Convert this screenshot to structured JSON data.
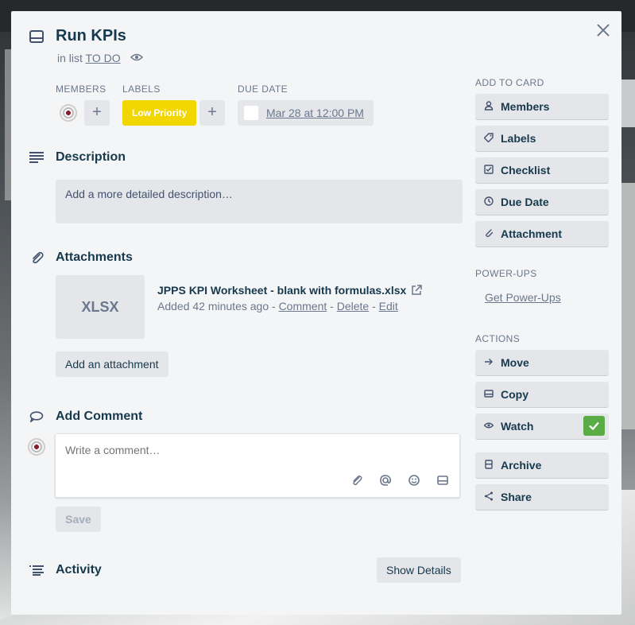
{
  "card": {
    "title": "Run KPIs",
    "in_list_prefix": "in list",
    "list_name": "TO DO"
  },
  "fields": {
    "members_label": "MEMBERS",
    "labels_label": "LABELS",
    "due_label": "DUE DATE",
    "label_chip": "Low Priority",
    "label_color": "#f2d600",
    "due_date": "Mar 28 at 12:00 PM"
  },
  "description": {
    "heading": "Description",
    "placeholder": "Add a more detailed description…"
  },
  "attachments": {
    "heading": "Attachments",
    "thumb_text": "XLSX",
    "file_name": "JPPS KPI Worksheet - blank with formulas.xlsx",
    "added": "Added 42 minutes ago",
    "sep": "-",
    "comment_link": "Comment",
    "delete_link": "Delete",
    "edit_link": "Edit",
    "add_button": "Add an attachment"
  },
  "comment": {
    "heading": "Add Comment",
    "placeholder": "Write a comment…",
    "save_button": "Save"
  },
  "activity": {
    "heading": "Activity",
    "show_details": "Show Details"
  },
  "sidebar": {
    "add_to_card_label": "ADD TO CARD",
    "add_items": [
      {
        "label": "Members",
        "icon": "person-icon"
      },
      {
        "label": "Labels",
        "icon": "tag-icon"
      },
      {
        "label": "Checklist",
        "icon": "checklist-icon"
      },
      {
        "label": "Due Date",
        "icon": "clock-icon"
      },
      {
        "label": "Attachment",
        "icon": "paperclip-icon"
      }
    ],
    "powerups_label": "POWER-UPS",
    "powerups_link": "Get Power-Ups",
    "actions_label": "ACTIONS",
    "actions": [
      {
        "label": "Move",
        "icon": "arrow-right-icon"
      },
      {
        "label": "Copy",
        "icon": "card-icon"
      },
      {
        "label": "Watch",
        "icon": "eye-icon"
      },
      {
        "label": "Archive",
        "icon": "archive-icon"
      },
      {
        "label": "Share",
        "icon": "share-icon"
      }
    ],
    "watch_active_color": "#5aac44"
  }
}
